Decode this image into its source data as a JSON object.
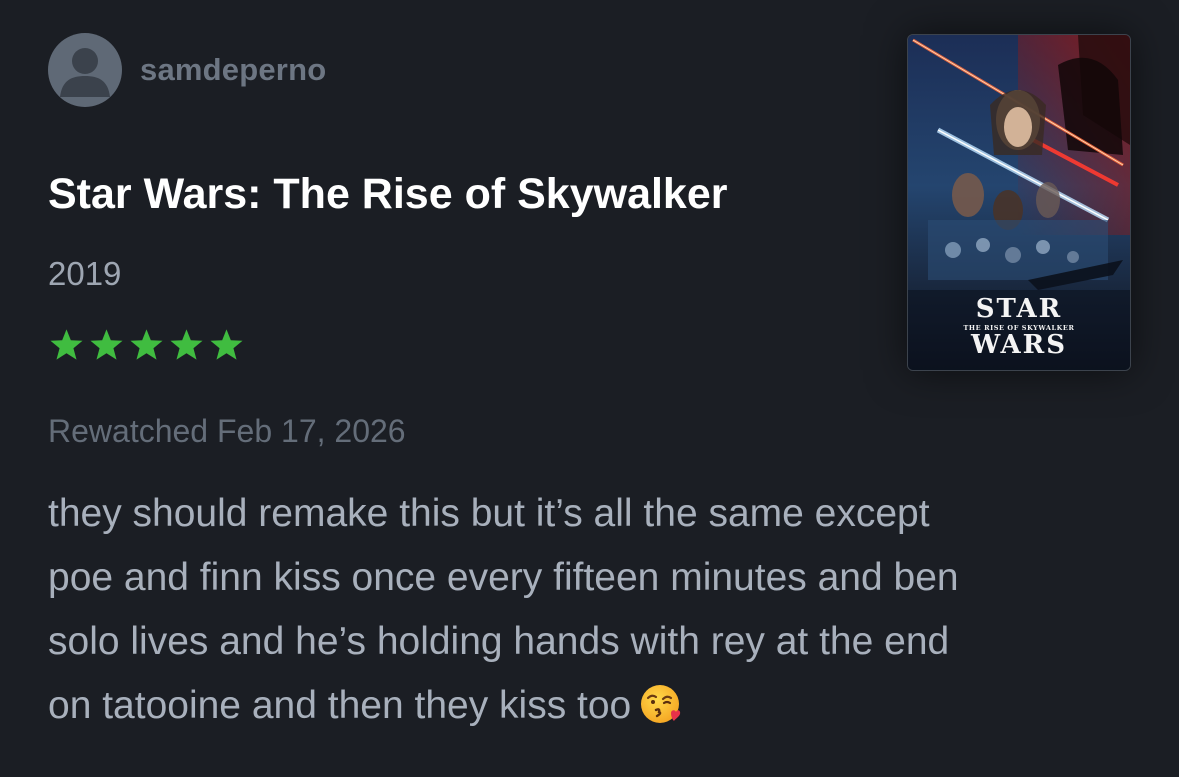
{
  "review": {
    "username": "samdeperno",
    "film_title": "Star Wars: The Rise of Skywalker",
    "year": "2019",
    "rating": {
      "stars": 5,
      "max": 5,
      "color": "#40bc40"
    },
    "watched_label": "Rewatched Feb 17, 2026",
    "body_lines": [
      "they should remake this but it’s all the same except",
      "poe and finn kiss once every fifteen minutes and ben",
      "solo lives and he’s holding hands with rey at the end",
      "on tatooine and then they kiss too"
    ],
    "body_emoji": "face-blowing-a-kiss-icon"
  },
  "poster": {
    "logo_line1": "STAR",
    "logo_tagline": "THE RISE OF SKYWALKER",
    "logo_line2": "WARS"
  },
  "theme": {
    "background": "#1b1e24",
    "title_color": "#ffffff",
    "muted_text": "#9ea6b2",
    "star_green": "#40bc40"
  }
}
